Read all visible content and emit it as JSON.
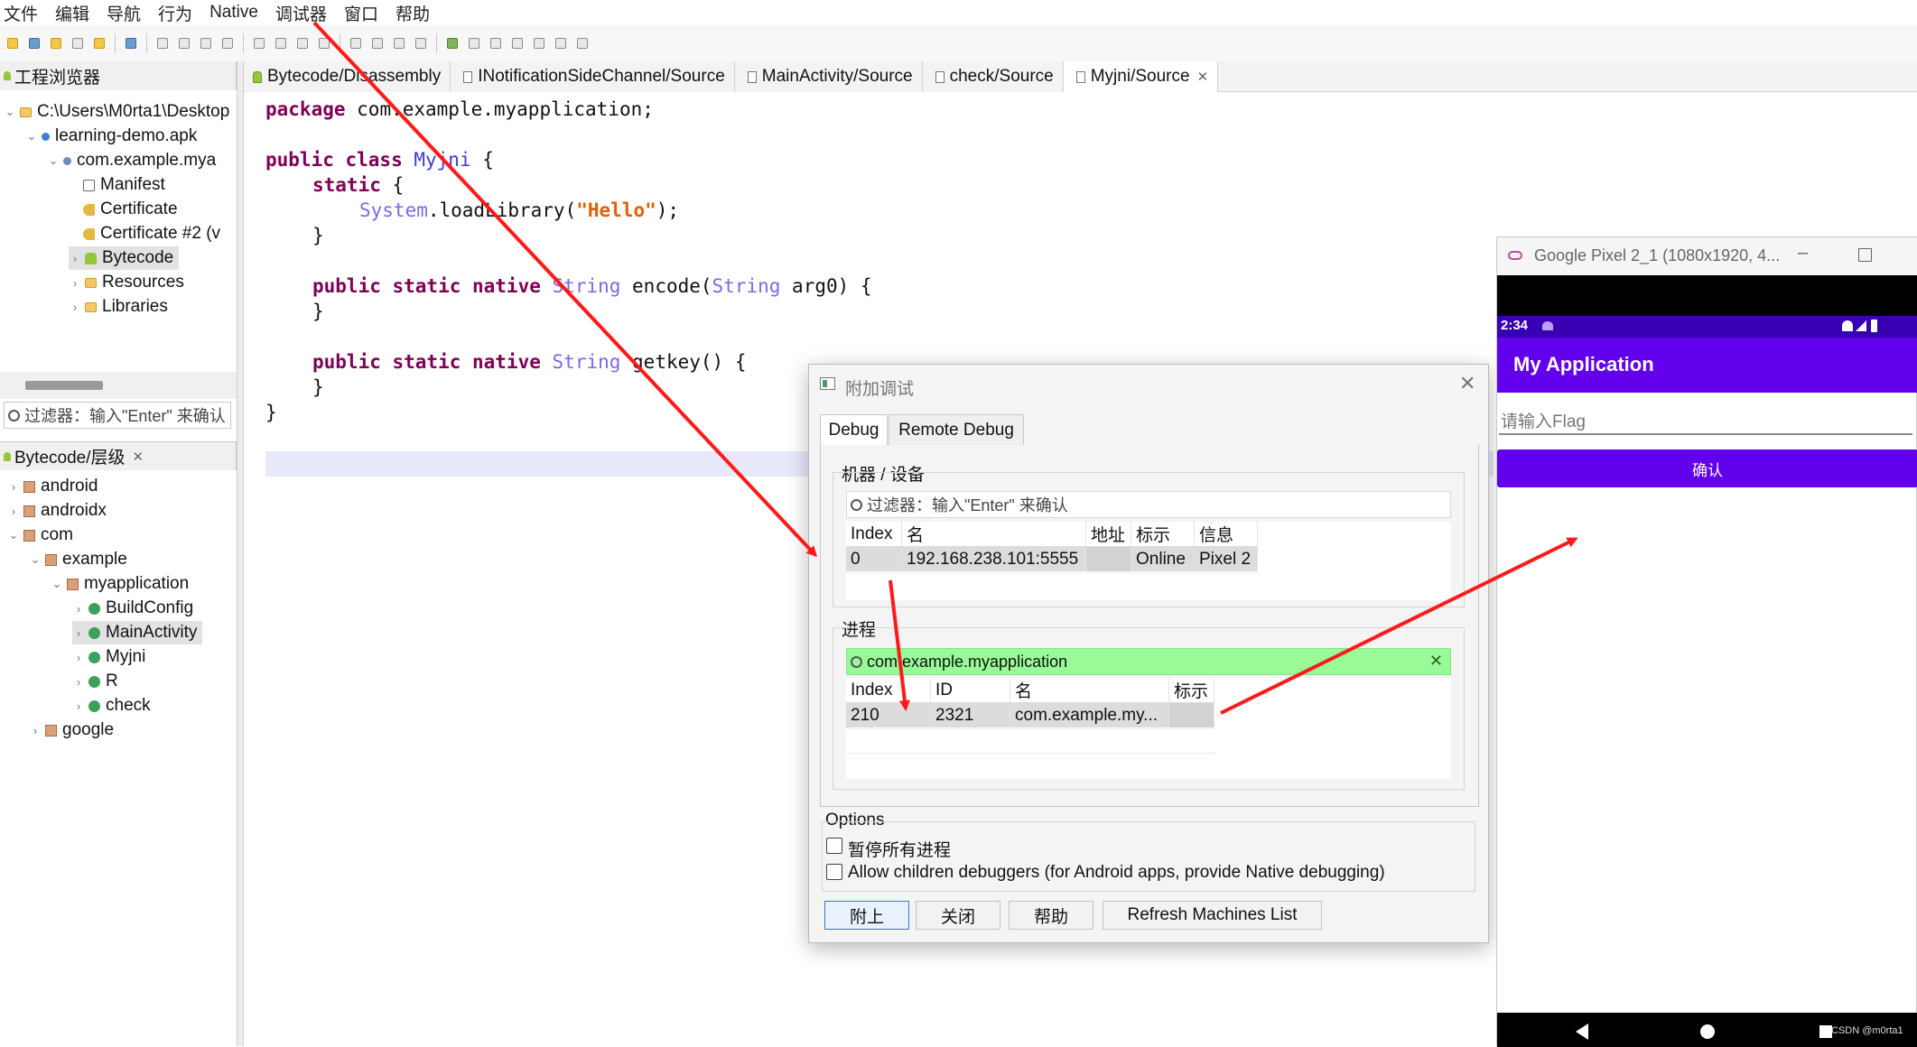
{
  "menu": [
    "文件",
    "编辑",
    "导航",
    "行为",
    "Native",
    "调试器",
    "窗口",
    "帮助"
  ],
  "project_explorer": {
    "tab": "工程浏览器",
    "tree": [
      "C:\\Users\\M0rta1\\Desktop",
      "learning-demo.apk",
      "com.example.mya",
      "Manifest",
      "Certificate",
      "Certificate #2 (v",
      "Bytecode",
      "Resources",
      "Libraries"
    ],
    "filter": "过滤器：输入\"Enter\" 来确认"
  },
  "hierarchy": {
    "tab": "Bytecode/层级",
    "tree": [
      "android",
      "androidx",
      "com",
      "example",
      "myapplication",
      "BuildConfig",
      "MainActivity",
      "Myjni",
      "R",
      "check",
      "google"
    ]
  },
  "editor_tabs": [
    "Bytecode/Disassembly",
    "INotificationSideChannel/Source",
    "MainActivity/Source",
    "check/Source",
    "Myjni/Source"
  ],
  "code": {
    "l1_kw": "package",
    "l1_rest": " com.example.myapplication;",
    "l2_kw": "public class",
    "l2_name": "Myjni",
    "l2_rest": " {",
    "l3_kw": "static",
    "l3_rest": " {",
    "l4_cls": "System",
    "l4_mid": ".loadLibrary(",
    "l4_str": "\"Hello\"",
    "l4_end": ");",
    "close": "}",
    "l6_kw": "public static native",
    "l6_ty": "String",
    "l6_mid": " encode(",
    "l6_ty2": "String",
    "l6_end": " arg0) {",
    "l8_kw": "public static native",
    "l8_ty": "String",
    "l8_end": " getkey() {"
  },
  "dialog": {
    "title": "附加调试",
    "tabs": [
      "Debug",
      "Remote Debug"
    ],
    "machines_group": "机器 / 设备",
    "machines_filter": "过滤器：输入\"Enter\" 来确认",
    "machines_cols": [
      "Index",
      "名",
      "地址",
      "标示",
      "信息"
    ],
    "machines_rows": [
      [
        "0",
        "192.168.238.101:5555",
        "",
        "Online",
        "Pixel 2"
      ]
    ],
    "process_group": "进程",
    "process_filter": "com.example.myapplication",
    "process_cols": [
      "Index",
      "ID",
      "名",
      "标示"
    ],
    "process_rows": [
      [
        "210",
        "2321",
        "com.example.my...",
        ""
      ]
    ],
    "options_group": "Options",
    "opt_pause": "暂停所有进程",
    "opt_children": "Allow children debuggers (for Android apps, provide Native debugging)",
    "buttons": [
      "附上",
      "关闭",
      "帮助",
      "Refresh Machines List"
    ]
  },
  "emulator": {
    "title": "Google Pixel 2_1 (1080x1920, 4...",
    "time": "2:34",
    "app_title": "My Application",
    "input_placeholder": "请输入Flag",
    "confirm": "确认",
    "watermark": "CSDN @m0rta1",
    "accent": "#6200ee"
  }
}
